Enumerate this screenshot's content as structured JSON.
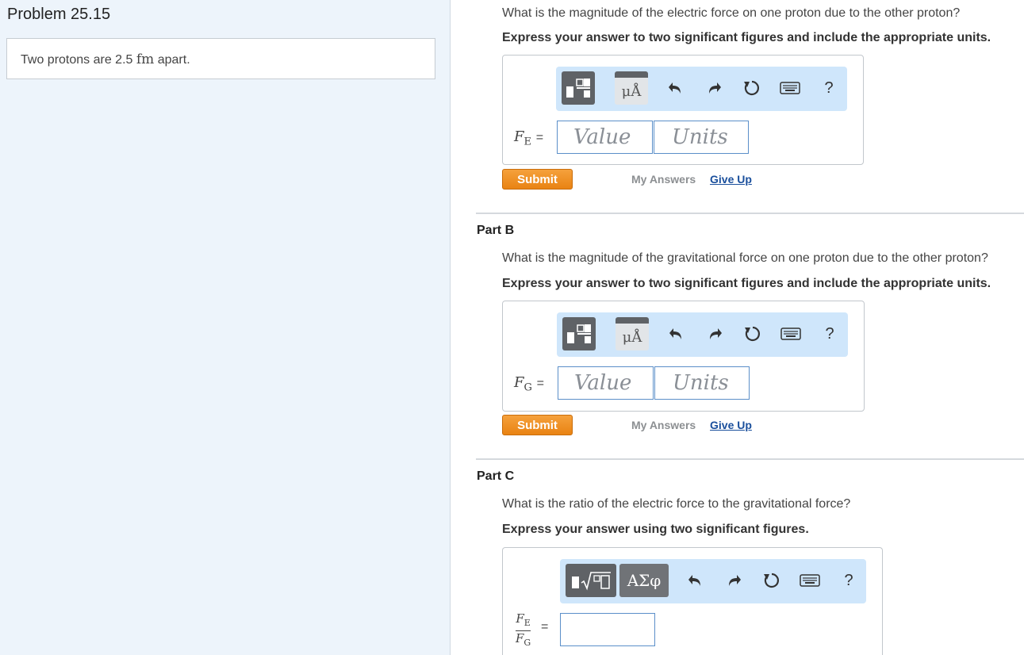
{
  "problem": {
    "title": "Problem 25.15",
    "statement_prefix": "Two protons are 2.5 ",
    "statement_unit": "fm",
    "statement_suffix": " apart."
  },
  "partA": {
    "question": "What is the magnitude of the electric force on one proton due to the other proton?",
    "instruction": "Express your answer to two significant figures and include the appropriate units.",
    "var_symbol": "F",
    "var_sub": "E",
    "equals": "=",
    "value_placeholder": "Value",
    "units_placeholder": "Units",
    "submit": "Submit",
    "my_answers": "My Answers",
    "give_up": "Give Up"
  },
  "partB": {
    "header": "Part B",
    "question": "What is the magnitude of the gravitational force on one proton due to the other proton?",
    "instruction": "Express your answer to two significant figures and include the appropriate units.",
    "var_symbol": "F",
    "var_sub": "G",
    "equals": "=",
    "value_placeholder": "Value",
    "units_placeholder": "Units",
    "submit": "Submit",
    "my_answers": "My Answers",
    "give_up": "Give Up"
  },
  "partC": {
    "header": "Part C",
    "question": "What is the ratio of the electric force to the gravitational force?",
    "instruction": "Express your answer using two significant figures.",
    "num_symbol": "F",
    "num_sub": "E",
    "den_symbol": "F",
    "den_sub": "G",
    "equals": "="
  },
  "toolbar": {
    "units_button": "μÅ",
    "greek_button": "ΑΣφ",
    "help": "?",
    "icons": [
      "templates-icon",
      "units-icon",
      "undo-icon",
      "redo-icon",
      "reset-icon",
      "keyboard-icon",
      "help-icon"
    ]
  },
  "colors": {
    "submit": "#e98313",
    "toolbar": "#cfe6fb",
    "link": "#1a4f9c",
    "left_panel": "#edf4fb"
  }
}
